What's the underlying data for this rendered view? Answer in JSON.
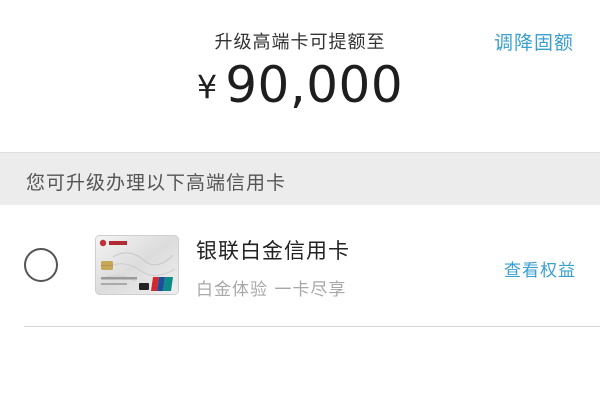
{
  "header": {
    "limit_caption": "升级高端卡可提额至",
    "adjust_link": "调降固额",
    "currency_symbol": "¥",
    "amount": "90,000"
  },
  "section": {
    "title": "您可升级办理以下高端信用卡"
  },
  "cards": [
    {
      "name": "银联白金信用卡",
      "description": "白金体验 一卡尽享",
      "benefits_link": "查看权益",
      "selected": false
    }
  ],
  "colors": {
    "link": "#3a9fd1",
    "section_bg": "#ececec",
    "muted_text": "#a8a8a8"
  }
}
